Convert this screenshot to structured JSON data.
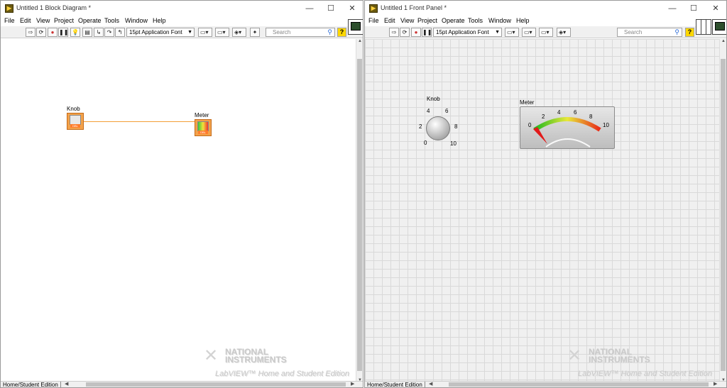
{
  "block_diagram": {
    "title": "Untitled 1 Block Diagram *",
    "menu": [
      "File",
      "Edit",
      "View",
      "Project",
      "Operate",
      "Tools",
      "Window",
      "Help"
    ],
    "font_select": "15pt Application Font",
    "search_placeholder": "Search",
    "nodes": {
      "knob_label": "Knob",
      "meter_label": "Meter",
      "terminal_type": "DBL"
    },
    "watermark": {
      "brand": "NATIONAL INSTRUMENTS",
      "edition": "LabVIEW™ Home and Student Edition"
    },
    "status": "Home/Student Edition"
  },
  "front_panel": {
    "title": "Untitled 1 Front Panel *",
    "menu": [
      "File",
      "Edit",
      "View",
      "Project",
      "Operate",
      "Tools",
      "Window",
      "Help"
    ],
    "font_select": "15pt Application Font",
    "search_placeholder": "Search",
    "knob": {
      "label": "Knob",
      "ticks": [
        "0",
        "2",
        "4",
        "6",
        "8",
        "10"
      ],
      "value": 0
    },
    "meter": {
      "label": "Meter",
      "ticks": [
        "0",
        "2",
        "4",
        "6",
        "8",
        "10"
      ],
      "value": 0
    },
    "watermark": {
      "brand": "NATIONAL INSTRUMENTS",
      "edition": "LabVIEW™ Home and Student Edition"
    },
    "status": "Home/Student Edition"
  },
  "window_controls": {
    "minimize": "—",
    "maximize": "☐",
    "close": "✕"
  },
  "toolbar_icons": [
    "run-arrow-icon",
    "run-continuous-icon",
    "abort-icon",
    "pause-icon",
    "highlight-execution-icon",
    "retain-wire-values-icon",
    "step-into-icon",
    "step-over-icon",
    "step-out-icon",
    "align-icon",
    "distribute-icon",
    "reorder-icon",
    "cleanup-icon",
    "help-icon"
  ],
  "colors": {
    "wire": "#f39e37",
    "terminal": "#f3a24a",
    "panel_bg": "#f0f0f0",
    "grid": "#d9d9d9"
  }
}
